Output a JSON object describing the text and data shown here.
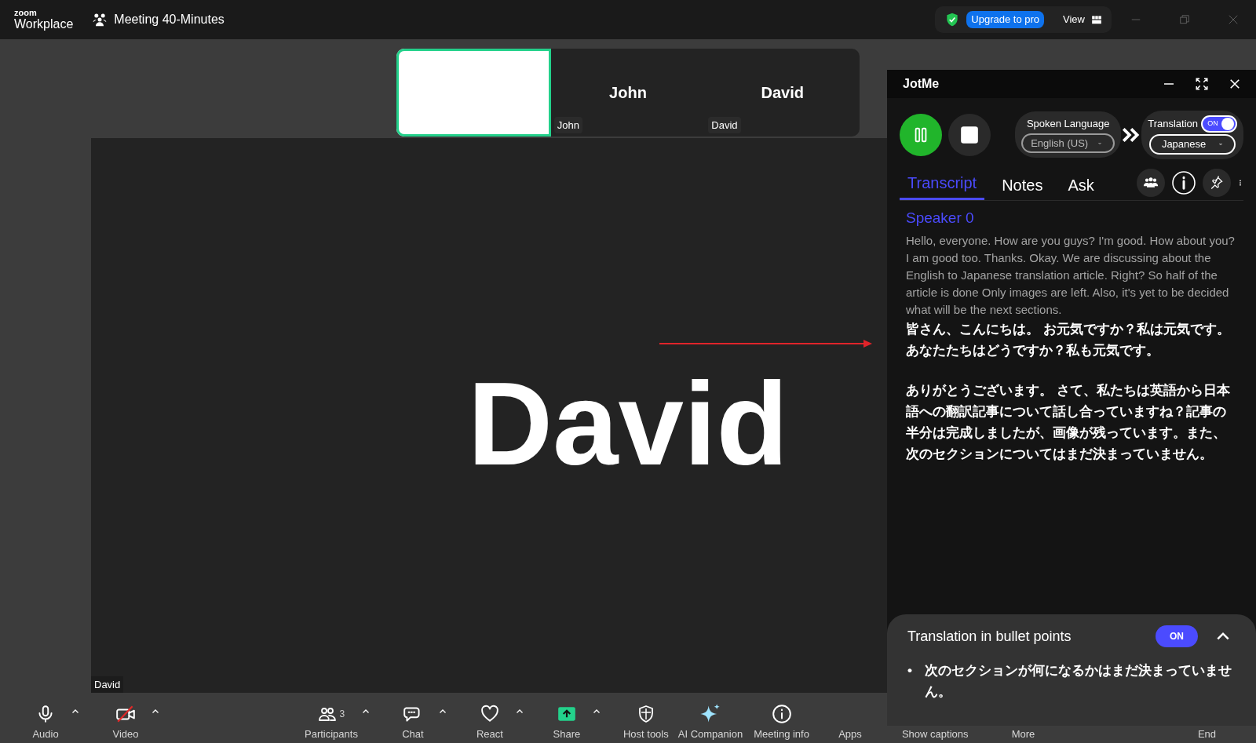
{
  "top_bar": {
    "logo_top": "zoom",
    "logo_bottom": "Workplace",
    "meeting_title": "Meeting 40-Minutes",
    "upgrade_button": "Upgrade to pro",
    "view_button": "View"
  },
  "thumbnails": [
    {
      "kind": "blank",
      "speaking": true
    },
    {
      "kind": "name",
      "title": "John",
      "label": "John",
      "speaking": false
    },
    {
      "kind": "name",
      "title": "David",
      "label": "David",
      "speaking": false
    }
  ],
  "main_video": {
    "name": "David",
    "label": "David"
  },
  "toolbar": [
    {
      "label": "Audio",
      "has_menu": true,
      "muted": false
    },
    {
      "label": "Video",
      "has_menu": true,
      "muted": true
    },
    {
      "label": "Participants",
      "count": "3",
      "has_menu": true
    },
    {
      "label": "Chat",
      "has_menu": true
    },
    {
      "label": "React",
      "has_menu": true
    },
    {
      "label": "Share",
      "has_menu": true
    },
    {
      "label": "Host tools",
      "has_menu": false
    },
    {
      "label": "AI Companion",
      "has_menu": false
    },
    {
      "label": "Meeting info",
      "has_menu": false
    },
    {
      "label": "Apps",
      "has_menu": false
    },
    {
      "label": "Show captions",
      "has_menu": false
    },
    {
      "label": "More",
      "has_menu": false
    },
    {
      "label": "End",
      "has_menu": false
    }
  ],
  "jotme": {
    "title": "JotMe",
    "spoken_language": {
      "label": "Spoken Language",
      "value": "English (US)"
    },
    "translation": {
      "label": "Translation",
      "on": true,
      "toggle_text": "ON",
      "value": "Japanese"
    },
    "tabs": [
      {
        "label": "Transcript",
        "selected": true
      },
      {
        "label": "Notes",
        "selected": false
      },
      {
        "label": "Ask",
        "selected": false
      }
    ],
    "transcript": [
      {
        "speaker": "Speaker 0",
        "original": "Hello, everyone. How are you guys? I'm good. How about you? I am good too. Thanks. Okay. We are discussing about the English to Japanese translation article. Right? So half of the article is done Only images are left. Also, it's yet to be decided what will be the next sections.",
        "translation": [
          "皆さん、こんにちは。 お元気ですか？私は元気です。あなたたちはどうですか？私も元気です。",
          "ありがとうございます。 さて、私たちは英語から日本語への翻訳記事について話し合っていますね？記事の半分は完成しましたが、画像が残っています。また、次のセクションについてはまだ決まっていません。"
        ]
      }
    ],
    "bullet_panel": {
      "title": "Translation in bullet points",
      "on": true,
      "toggle_text": "ON",
      "expanded": true,
      "bullets": [
        {
          "marker": "•",
          "text": "次のセクションが何になるかはまだ決まっていません。"
        }
      ]
    }
  }
}
